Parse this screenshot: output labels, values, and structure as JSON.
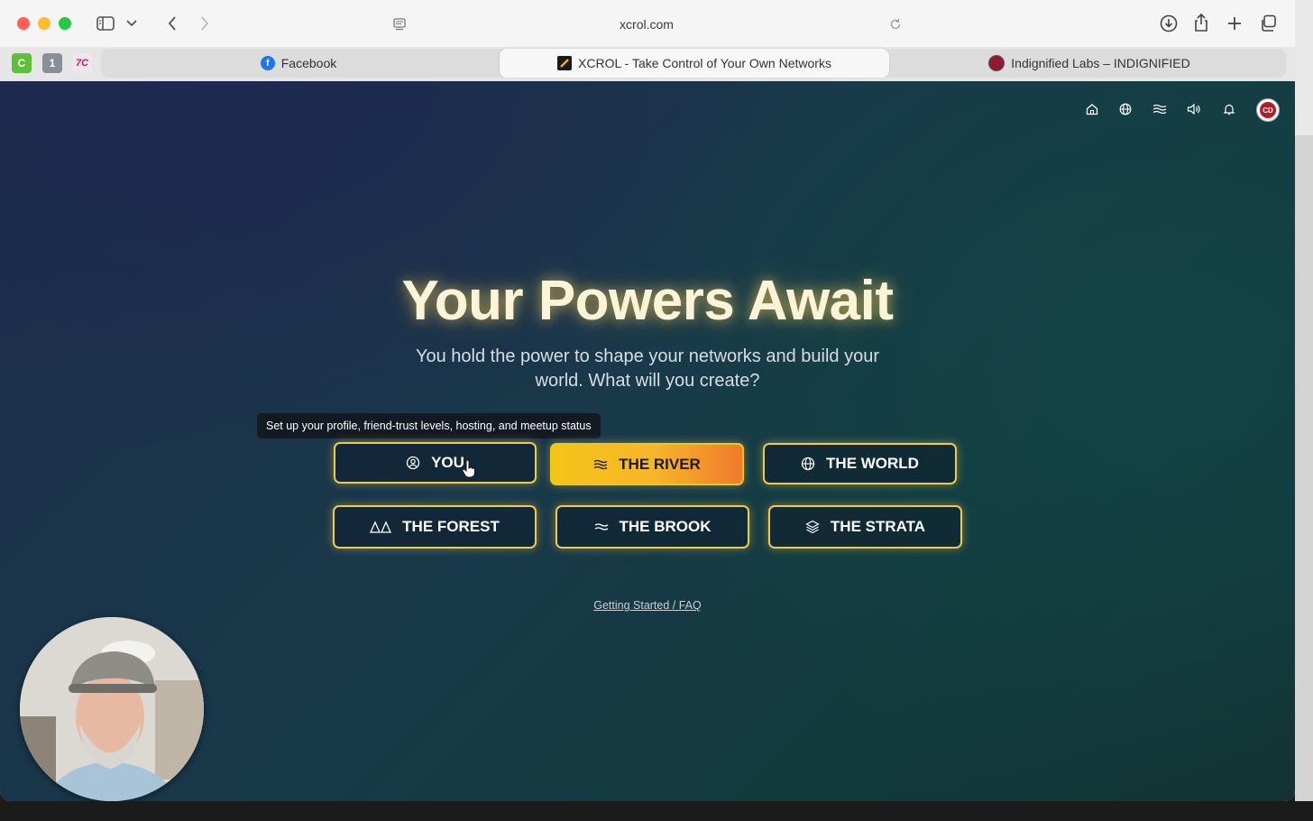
{
  "browser": {
    "url": "xcrol.com",
    "pinned_tabs": [
      {
        "label": "C",
        "color": "#5fbf3a"
      },
      {
        "label": "1",
        "color": "#8a8f96"
      },
      {
        "label": "7C",
        "color": "#b3246a"
      }
    ],
    "tabs": [
      {
        "title": "Facebook",
        "icon": "facebook-icon",
        "active": false
      },
      {
        "title": "XCROL - Take Control of Your Own Networks",
        "icon": "xcrol-icon",
        "active": true
      },
      {
        "title": "Indignified Labs – INDIGNIFIED",
        "icon": "indignified-icon",
        "active": false
      }
    ]
  },
  "page": {
    "nav_icons": [
      "home-icon",
      "globe-icon",
      "river-icon",
      "speaker-icon",
      "bell-icon"
    ],
    "avatar_text": "CD",
    "title": "Your Powers Await",
    "subtitle": "You hold the power to shape your networks and build your world. What will you create?",
    "tooltip": "Set up your profile, friend-trust levels, hosting, and meetup status",
    "buttons": [
      {
        "label": "YOU",
        "icon": "user-circle-icon",
        "active": false
      },
      {
        "label": "THE RIVER",
        "icon": "waves-icon",
        "active": true
      },
      {
        "label": "THE WORLD",
        "icon": "globe-icon",
        "active": false
      },
      {
        "label": "THE FOREST",
        "icon": "trees-icon",
        "active": false
      },
      {
        "label": "THE BROOK",
        "icon": "wave-icon",
        "active": false
      },
      {
        "label": "THE STRATA",
        "icon": "layers-icon",
        "active": false
      }
    ],
    "faq_link": "Getting Started / FAQ"
  },
  "colors": {
    "accent_border": "#f2c94c",
    "active_gradient_start": "#f5c518",
    "active_gradient_end": "#f07a2c",
    "background": "#1a3444"
  }
}
